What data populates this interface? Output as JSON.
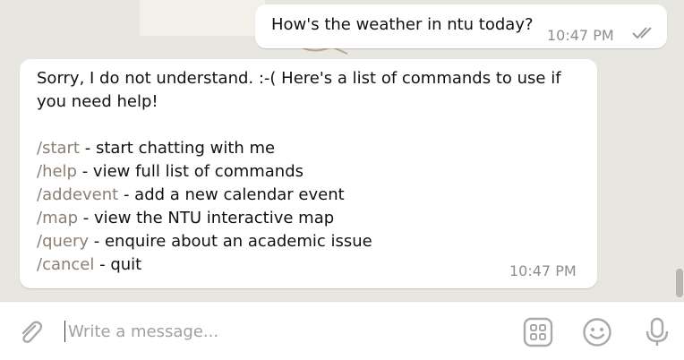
{
  "chat": {
    "outgoing": {
      "text": "How's the weather in ntu today?",
      "time": "10:47 PM",
      "status_icon": "double-check-icon"
    },
    "incoming": {
      "intro": "Sorry, I do not understand. :-( Here's a list of commands to use if you need help!",
      "commands": [
        {
          "cmd": "/start",
          "desc": " - start chatting with me"
        },
        {
          "cmd": "/help",
          "desc": " - view full list of commands"
        },
        {
          "cmd": "/addevent",
          "desc": " - add a new calendar event"
        },
        {
          "cmd": "/map",
          "desc": " - view the NTU interactive map"
        },
        {
          "cmd": "/query",
          "desc": " - enquire about an academic issue"
        },
        {
          "cmd": "/cancel",
          "desc": " - quit"
        }
      ],
      "time": "10:47 PM"
    }
  },
  "composer": {
    "placeholder": "Write a message...",
    "value": "",
    "icons": {
      "attach": "paperclip-icon",
      "apps": "bot-commands-icon",
      "emoji": "emoji-icon",
      "voice": "microphone-icon"
    }
  },
  "colors": {
    "background": "#e8e6e1",
    "bubble": "#ffffff",
    "command": "#8a7f74",
    "timestamp": "#8d8d8d",
    "icon": "#a9a9a9"
  }
}
